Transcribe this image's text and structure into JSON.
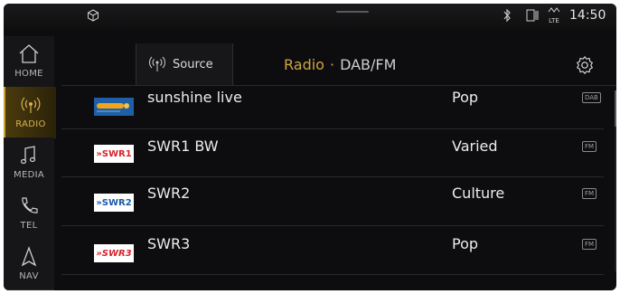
{
  "status": {
    "time": "14:50",
    "lte_label": "LTE"
  },
  "sidebar": {
    "items": [
      {
        "label": "HOME",
        "icon": "home-icon"
      },
      {
        "label": "RADIO",
        "icon": "radio-icon",
        "active": true
      },
      {
        "label": "MEDIA",
        "icon": "music-note-icon"
      },
      {
        "label": "TEL",
        "icon": "phone-icon"
      },
      {
        "label": "NAV",
        "icon": "navigation-arrow-icon"
      }
    ]
  },
  "header": {
    "source_label": "Source",
    "title": "Radio",
    "separator": "·",
    "subtitle": "DAB/FM"
  },
  "stations": [
    {
      "name": "sunshine live",
      "genre": "Pop",
      "band": "DAB",
      "logo": "sunshine-live-logo"
    },
    {
      "name": "SWR1 BW",
      "genre": "Varied",
      "band": "FM",
      "logo": "swr1-logo",
      "logo_text": "SWR1"
    },
    {
      "name": "SWR2",
      "genre": "Culture",
      "band": "FM",
      "logo": "swr2-logo",
      "logo_text": "SWR2"
    },
    {
      "name": "SWR3",
      "genre": "Pop",
      "band": "FM",
      "logo": "swr3-logo",
      "logo_text": "SWR3"
    }
  ],
  "colors": {
    "accent": "#cfa541",
    "background": "#0d0d0f",
    "swr_red": "#d8232a",
    "swr_blue": "#1a5aa8"
  }
}
